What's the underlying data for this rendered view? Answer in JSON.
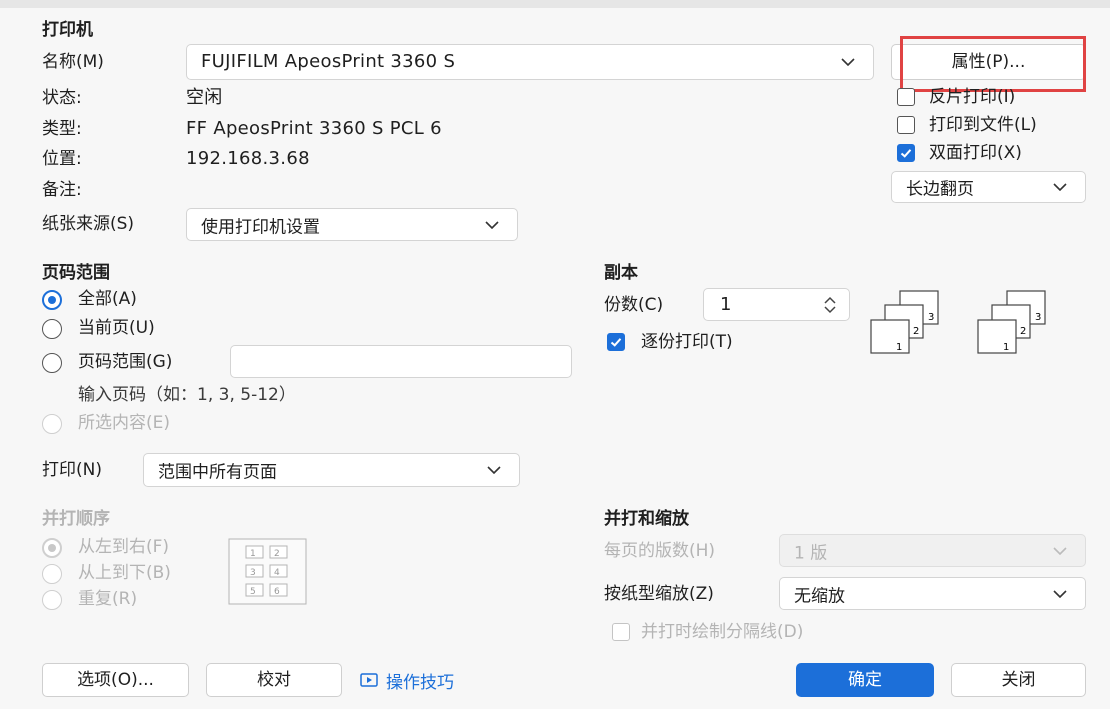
{
  "printer": {
    "section_title": "打印机",
    "name_label": "名称(M)",
    "name_value": "FUJIFILM ApeosPrint 3360 S",
    "status_label": "状态:",
    "status_value": "空闲",
    "type_label": "类型:",
    "type_value": "FF ApeosPrint 3360 S PCL 6",
    "location_label": "位置:",
    "location_value": "192.168.3.68",
    "comment_label": "备注:",
    "paper_source_label": "纸张来源(S)",
    "paper_source_value": "使用打印机设置",
    "properties_button": "属性(P)...",
    "reverse_print_label": "反片打印(I)",
    "print_to_file_label": "打印到文件(L)",
    "duplex_label": "双面打印(X)",
    "duplex_mode_value": "长边翻页"
  },
  "page_range": {
    "section_title": "页码范围",
    "all_label": "全部(A)",
    "current_label": "当前页(U)",
    "range_label": "页码范围(G)",
    "range_value": "",
    "hint": "输入页码（如：1, 3, 5-12）",
    "selection_label": "所选内容(E)",
    "print_label": "打印(N)",
    "print_value": "范围中所有页面"
  },
  "copies": {
    "section_title": "副本",
    "count_label": "份数(C)",
    "count_value": "1",
    "collate_label": "逐份打印(T)",
    "collate_icon_numbers": [
      "1",
      "2",
      "3"
    ]
  },
  "order": {
    "section_title": "并打顺序",
    "left_to_right": "从左到右(F)",
    "top_to_bottom": "从上到下(B)",
    "repeat": "重复(R)",
    "grid_numbers": [
      "1",
      "2",
      "3",
      "4",
      "5",
      "6"
    ]
  },
  "scaling": {
    "section_title": "并打和缩放",
    "pages_per_sheet_label": "每页的版数(H)",
    "pages_per_sheet_value": "1 版",
    "scale_label": "按纸型缩放(Z)",
    "scale_value": "无缩放",
    "separator_label": "并打时绘制分隔线(D)"
  },
  "footer": {
    "options_button": "选项(O)...",
    "proof_button": "校对",
    "tips_link": "操作技巧",
    "ok_button": "确定",
    "close_button": "关闭"
  },
  "colors": {
    "accent": "#1c6fd9",
    "highlight": "#e04343"
  }
}
